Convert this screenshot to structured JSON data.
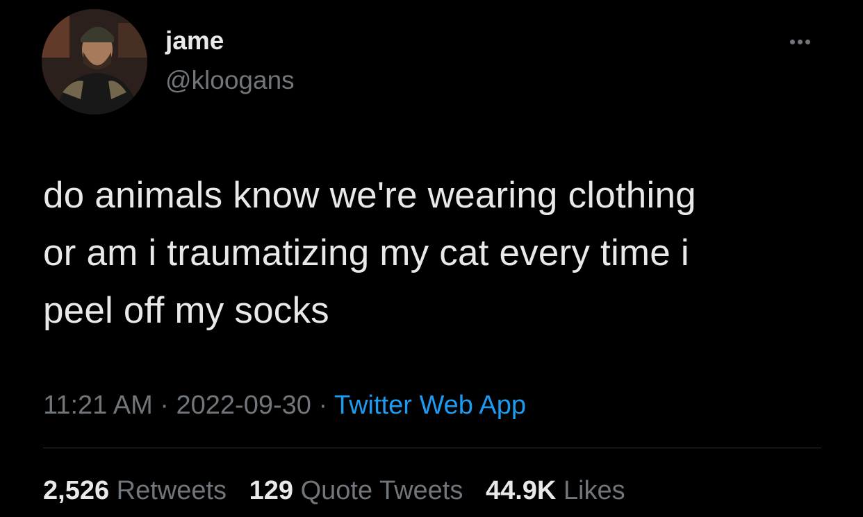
{
  "author": {
    "name": "jame",
    "handle": "@kloogans"
  },
  "tweet": {
    "text_lines": [
      "do animals know we're wearing clothing",
      "or am i traumatizing my cat every time i",
      "peel off my socks"
    ],
    "time": "11:21 AM",
    "separator": "·",
    "date": "2022-09-30",
    "source": "Twitter Web App"
  },
  "stats": {
    "retweets_count": "2,526",
    "retweets_label": "Retweets",
    "quotes_count": "129",
    "quotes_label": "Quote Tweets",
    "likes_count": "44.9K",
    "likes_label": "Likes"
  },
  "icons": {
    "more": "more-horizontal-icon"
  },
  "colors": {
    "background": "#000000",
    "primary_text": "#e7e9ea",
    "secondary_text": "#71767b",
    "link": "#1d9bf0",
    "divider": "#2f3336"
  }
}
